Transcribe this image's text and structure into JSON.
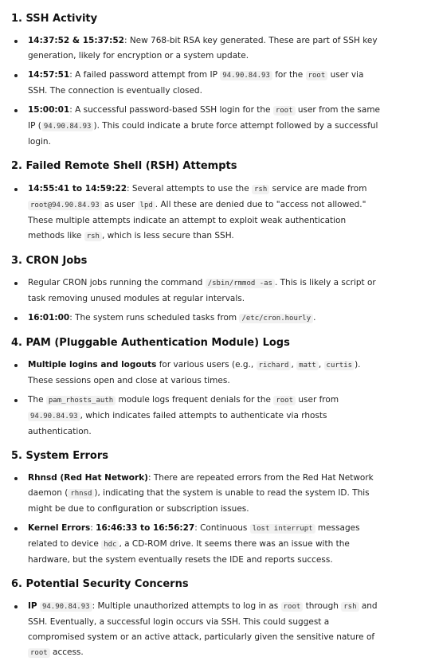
{
  "sections": [
    {
      "title": "1. SSH Activity",
      "items": [
        {
          "b1": "14:37:52 & 15:37:52",
          "t1": ": New 768-bit RSA key generated. These are part of SSH key generation, likely for encryption or a system update."
        },
        {
          "b1": "14:57:51",
          "t1": ": A failed password attempt from IP ",
          "c1": "94.90.84.93",
          "t2": " for the ",
          "c2": "root",
          "t3": " user via SSH. The connection is eventually closed."
        },
        {
          "b1": "15:00:01",
          "t1": ": A successful password-based SSH login for the ",
          "c1": "root",
          "t2": " user from the same IP (",
          "c2": "94.90.84.93",
          "t3": "). This could indicate a brute force attempt followed by a successful login."
        }
      ]
    },
    {
      "title": "2. Failed Remote Shell (RSH) Attempts",
      "items": [
        {
          "b1": "14:55:41 to 14:59:22",
          "t1": ": Several attempts to use the ",
          "c1": "rsh",
          "t2": " service are made from ",
          "c2": "root@94.90.84.93",
          "t3": " as user ",
          "c3": "lpd",
          "t4": ". All these are denied due to \"access not allowed.\" These multiple attempts indicate an attempt to exploit weak authentication methods like ",
          "c4": "rsh",
          "t5": ", which is less secure than SSH."
        }
      ]
    },
    {
      "title": "3. CRON Jobs",
      "items": [
        {
          "t0": "Regular CRON jobs running the command ",
          "c1": "/sbin/rmmod -as",
          "t1": ". This is likely a script or task removing unused modules at regular intervals."
        },
        {
          "b1": "16:01:00",
          "t1": ": The system runs scheduled tasks from ",
          "c1": "/etc/cron.hourly",
          "t2": "."
        }
      ]
    },
    {
      "title": "4. PAM (Pluggable Authentication Module) Logs",
      "items": [
        {
          "b1": "Multiple logins and logouts",
          "t1": " for various users (e.g., ",
          "c1": "richard",
          "t2": ", ",
          "c2": "matt",
          "t3": ", ",
          "c3": "curtis",
          "t4": "). These sessions open and close at various times."
        },
        {
          "t0": "The ",
          "c1": "pam_rhosts_auth",
          "t1": " module logs frequent denials for the ",
          "c2": "root",
          "t2": " user from ",
          "c3": "94.90.84.93",
          "t3": ", which indicates failed attempts to authenticate via rhosts authentication."
        }
      ]
    },
    {
      "title": "5. System Errors",
      "items": [
        {
          "b1": "Rhnsd (Red Hat Network)",
          "t1": ": There are repeated errors from the Red Hat Network daemon (",
          "c1": "rhnsd",
          "t2": "), indicating that the system is unable to read the system ID. This might be due to configuration or subscription issues."
        },
        {
          "b1": "Kernel Errors",
          "t1": ": ",
          "b2": "16:46:33 to 16:56:27",
          "t2": ": Continuous ",
          "c1": "lost interrupt",
          "t3": " messages related to device ",
          "c2": "hdc",
          "t4": ", a CD-ROM drive. It seems there was an issue with the hardware, but the system eventually resets the IDE and reports success."
        }
      ]
    },
    {
      "title": "6. Potential Security Concerns",
      "items": [
        {
          "b1": "IP",
          "t1": " ",
          "c1": "94.90.84.93",
          "t2": ": Multiple unauthorized attempts to log in as ",
          "c2": "root",
          "t3": " through ",
          "c3": "rsh",
          "t4": " and SSH. Eventually, a successful login occurs via SSH. This could suggest a compromised system or an active attack, particularly given the sensitive nature of ",
          "c4": "root",
          "t5": " access."
        }
      ]
    }
  ]
}
